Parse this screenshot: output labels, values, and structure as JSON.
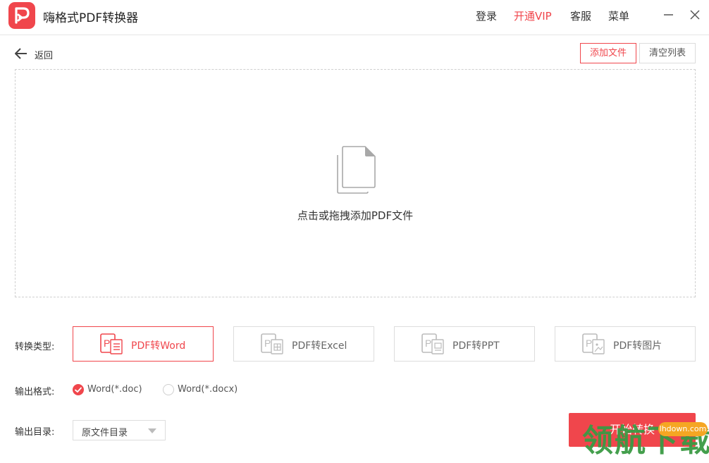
{
  "app": {
    "title": "嗨格式PDF转换器"
  },
  "topnav": {
    "login": "登录",
    "vip": "开通VIP",
    "service": "客服",
    "menu": "菜单"
  },
  "back": {
    "label": "返回"
  },
  "toolbar": {
    "add_file": "添加文件",
    "clear_list": "清空列表"
  },
  "dropzone": {
    "hint": "点击或拖拽添加PDF文件"
  },
  "convert_type": {
    "label": "转换类型:",
    "options": [
      {
        "label": "PDF转Word",
        "selected": true
      },
      {
        "label": "PDF转Excel",
        "selected": false
      },
      {
        "label": "PDF转PPT",
        "selected": false
      },
      {
        "label": "PDF转图片",
        "selected": false
      }
    ]
  },
  "output_format": {
    "label": "输出格式:",
    "options": [
      {
        "label": "Word(*.doc)",
        "checked": true
      },
      {
        "label": "Word(*.docx)",
        "checked": false
      }
    ]
  },
  "output_dir": {
    "label": "输出目录:",
    "value": "原文件目录"
  },
  "start": {
    "label": "开始转换"
  },
  "watermark": {
    "text": "领航下载",
    "site": "lhdown.com"
  },
  "colors": {
    "accent": "#f0464c",
    "watermark_green": "#3a9a44",
    "watermark_orange": "#f5a623"
  }
}
